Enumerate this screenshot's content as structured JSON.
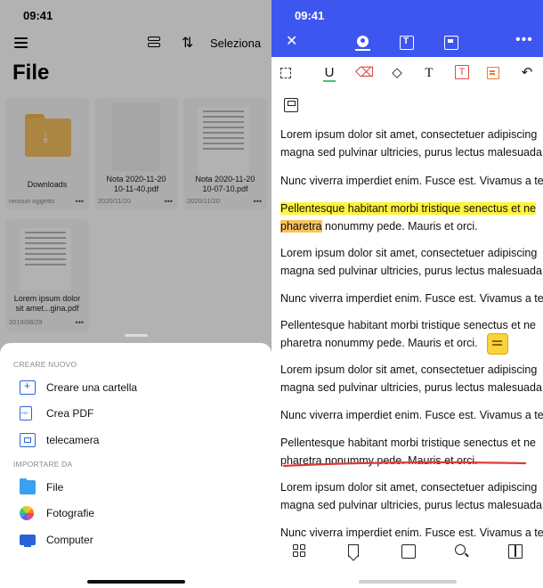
{
  "left": {
    "time": "09:41",
    "select_label": "Seleziona",
    "title": "File",
    "tiles": [
      {
        "name": "Downloads",
        "meta": "nessun oggetto",
        "dots": "•••"
      },
      {
        "name": "Nota 2020-11-20 10-11-40.pdf",
        "meta": "2020/11/20",
        "dots": "•••"
      },
      {
        "name": "Nota 2020-11-20 10-07-10.pdf",
        "meta": "2020/11/20",
        "dots": "•••"
      },
      {
        "name": "Lorem ipsum dolor sit amet...gina.pdf",
        "meta": "2019/08/29",
        "dots": "•••"
      }
    ],
    "sheet": {
      "create_header": "CREARE NUOVO",
      "create_items": [
        {
          "label": "Creare una cartella",
          "icon": "folder-plus-icon"
        },
        {
          "label": "Crea PDF",
          "icon": "pdf-icon"
        },
        {
          "label": "telecamera",
          "icon": "camera-scan-icon"
        }
      ],
      "import_header": "IMPORTARE DA",
      "import_items": [
        {
          "label": "File",
          "icon": "files-folder-icon"
        },
        {
          "label": "Fotografie",
          "icon": "photos-icon"
        },
        {
          "label": "Computer",
          "icon": "computer-wifi-icon"
        }
      ]
    },
    "colors": {
      "accent": "#2a63d9",
      "folder": "#f5c060"
    }
  },
  "right": {
    "time": "09:41",
    "colors": {
      "topbar": "#3e56f0",
      "highlight_yellow": "#fff43a",
      "highlight_orange": "#f9c25b",
      "underline_red": "#e03a3a"
    },
    "paragraphs": [
      {
        "line1": "Lorem ipsum dolor sit amet, consectetuer adipiscing",
        "line2": "magna sed pulvinar ultricies, purus lectus malesuada"
      },
      {
        "line1": "Nunc viverra imperdiet enim. Fusce est. Vivamus a te"
      },
      {
        "line1": "Pellentesque habitant morbi tristique senectus et ne",
        "line2a": "pharetra",
        "line2b": " nonummy pede. Mauris et orci."
      },
      {
        "line1": "Lorem ipsum dolor sit amet, consectetuer adipiscing",
        "line2": "magna sed pulvinar ultricies, purus lectus malesuada"
      },
      {
        "line1": "Nunc viverra imperdiet enim. Fusce est. Vivamus a te"
      },
      {
        "line1": "Pellentesque habitant morbi tristique senectus et ne",
        "line2": "pharetra nonummy pede. Mauris et orci."
      },
      {
        "line1": "Lorem ipsum dolor sit amet, consectetuer adipiscing",
        "line2": "magna sed pulvinar ultricies, purus lectus malesuada"
      },
      {
        "line1": "Nunc viverra imperdiet enim. Fusce est. Vivamus a te"
      },
      {
        "line1": "Pellentesque habitant morbi tristique senectus et ne",
        "line2": "pharetra nonummy pede. Mauris et orci."
      },
      {
        "line1": "Lorem ipsum dolor sit amet, consectetuer adipiscing",
        "line2": "magna sed pulvinar ultricies, purus lectus malesuada"
      },
      {
        "line1": "Nunc viverra imperdiet enim. Fusce est. Vivamus a te"
      }
    ]
  }
}
